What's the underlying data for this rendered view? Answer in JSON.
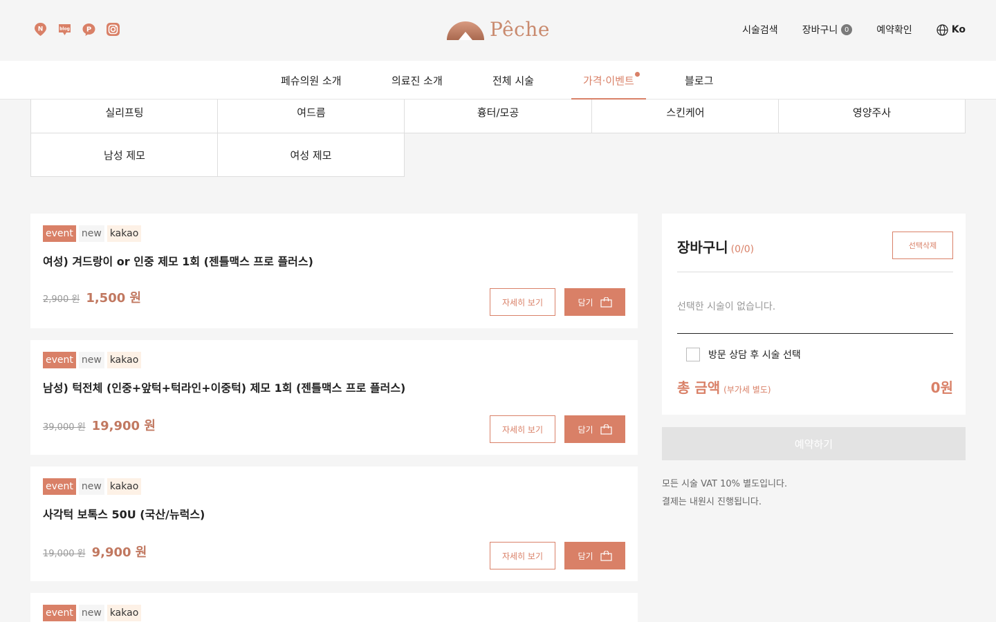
{
  "brand": {
    "name": "Pêche",
    "accent": "#d98067",
    "text_accent": "#c17860"
  },
  "social": [
    {
      "icon": "naver-map-icon",
      "glyph": "N"
    },
    {
      "icon": "blog-icon",
      "glyph": "blog"
    },
    {
      "icon": "naver-pay-icon",
      "glyph": "P"
    },
    {
      "icon": "instagram-icon",
      "glyph": ""
    }
  ],
  "util": {
    "search": "시술검색",
    "cart": "장바구니",
    "cart_count": "0",
    "reservation": "예약확인",
    "lang": "Ko"
  },
  "nav": [
    {
      "label": "페슈의원 소개"
    },
    {
      "label": "의료진 소개"
    },
    {
      "label": "전체 시술"
    },
    {
      "label": "가격·이벤트"
    },
    {
      "label": "블로그"
    }
  ],
  "categories": [
    {
      "label": "실리프팅"
    },
    {
      "label": "여드름"
    },
    {
      "label": "흉터/모공"
    },
    {
      "label": "스킨케어"
    },
    {
      "label": "영양주사"
    },
    {
      "label": "남성 제모"
    },
    {
      "label": "여성 제모"
    }
  ],
  "products": [
    {
      "tags": [
        "event",
        "new",
        "kakao"
      ],
      "title": "여성) 겨드랑이 or 인중 제모 1회 (젠틀맥스 프로 플러스)",
      "old_price": "2,900 원",
      "price": "1,500 원"
    },
    {
      "tags": [
        "event",
        "new",
        "kakao"
      ],
      "title": "남성) 턱전체 (인중+앞턱+턱라인+이중턱) 제모 1회 (젠틀맥스 프로 플러스)",
      "old_price": "39,000 원",
      "price": "19,900 원"
    },
    {
      "tags": [
        "event",
        "new",
        "kakao"
      ],
      "title": "사각턱 보톡스 50U (국산/뉴럭스)",
      "old_price": "19,000 원",
      "price": "9,900 원"
    },
    {
      "tags": [
        "event",
        "new",
        "kakao"
      ],
      "title": "",
      "old_price": "",
      "price": ""
    }
  ],
  "buttons": {
    "detail": "자세히 보기",
    "add": "담기"
  },
  "cart": {
    "title": "장바구니",
    "count": "(0/0)",
    "clear": "선택삭제",
    "empty": "선택한 시술이 없습니다.",
    "consult": "방문 상담 후 시술 선택",
    "total_label": "총 금액",
    "vat_note": "(부가세 별도)",
    "total_value": "0원",
    "reserve": "예약하기"
  },
  "notes": [
    "모든 시술 VAT 10% 별도입니다.",
    "결제는 내원시 진행됩니다."
  ]
}
